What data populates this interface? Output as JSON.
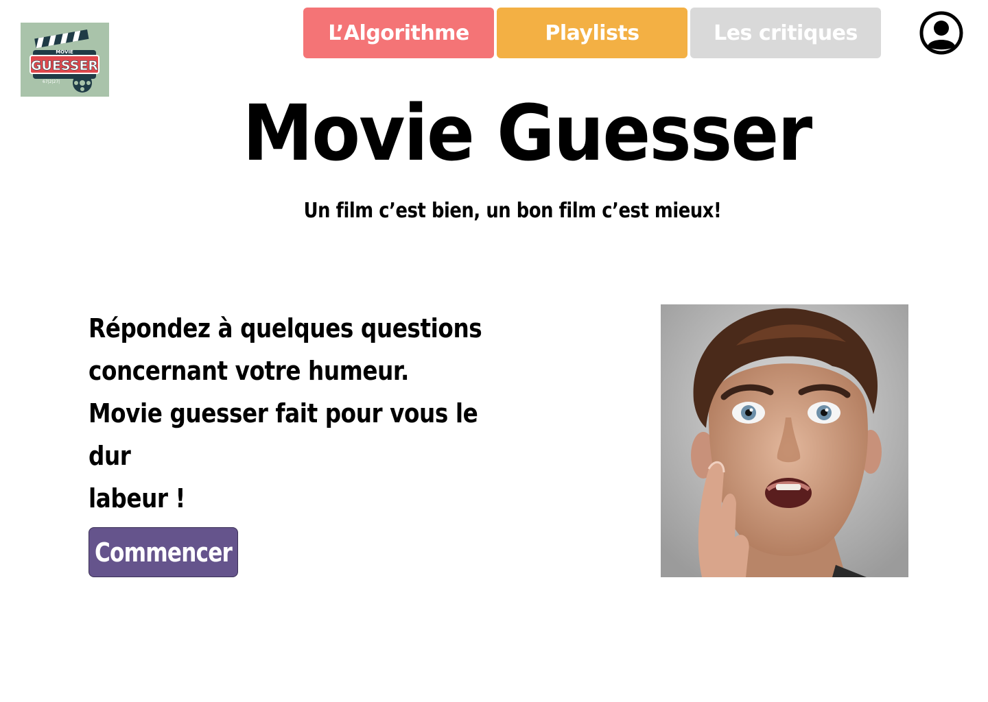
{
  "logo": {
    "top_text": "MOVIE",
    "main_text": "GUESSER",
    "bottom_text": "67|2|27|",
    "icon": "clapperboard-logo"
  },
  "nav": {
    "items": [
      {
        "label": "L’Algorithme",
        "color": "#f47476"
      },
      {
        "label": "Playlists",
        "color": "#f3b044"
      },
      {
        "label": "Les critiques",
        "color": "#d9d9d9"
      }
    ]
  },
  "account": {
    "icon": "user-account-icon"
  },
  "header": {
    "title": "Movie Guesser",
    "subtitle": "Un film c’est bien, un bon film c’est mieux!"
  },
  "main": {
    "intro_lines": [
      "Répondez à quelques questions",
      "concernant votre humeur.",
      "Movie guesser fait pour vous le dur",
      "labeur !"
    ],
    "start_label": "Commencer",
    "start_color": "#65548c",
    "hero_image": "surprised-man-portrait"
  }
}
